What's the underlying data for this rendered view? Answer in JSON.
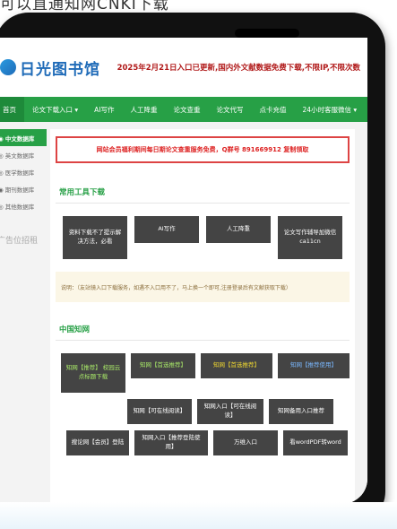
{
  "caption": "可以直通知网CNKI下载",
  "header": {
    "logo_text": "日光图书馆",
    "notice": "2025年2月21日入口已更新,国内外文献数据免费下载,不限IP,不限次数"
  },
  "nav": [
    {
      "label": "首页"
    },
    {
      "label": "论文下载入口 ▾"
    },
    {
      "label": "AI写作"
    },
    {
      "label": "人工降重"
    },
    {
      "label": "论文查重"
    },
    {
      "label": "论文代写"
    },
    {
      "label": "点卡充值"
    },
    {
      "label": "24小时客服微信 ▾"
    }
  ],
  "sidebar": {
    "items": [
      {
        "label": "◉ 中文数据库",
        "active": true
      },
      {
        "label": "◎ 英文数据库",
        "active": false
      },
      {
        "label": "◎ 医学数据库",
        "active": false
      },
      {
        "label": "◉ 期刊数据库",
        "active": false
      },
      {
        "label": "◎ 其他数据库",
        "active": false
      }
    ],
    "ad_label": "广告位招租"
  },
  "alert": "网站会员福利期间每日期论文查重服务免费，Q群号 891669912 复制领取",
  "tools": {
    "title": "常用工具下载",
    "buttons": [
      {
        "label": "资料下载不了提示解决方法，必看"
      },
      {
        "label": "AI写作"
      },
      {
        "label": "人工降重"
      },
      {
        "label": "论文写作辅导加微信 ca11cn"
      }
    ]
  },
  "tip": "说明：（友站镜入口下载服务，如遇不入口用不了，马上换一个即可,注册登录后有文献获取下载）",
  "cnki": {
    "title": "中国知网",
    "row1": [
      {
        "label": "知网【推荐】 校园云点标题下载",
        "color": "green"
      },
      {
        "label": "知网【首选推荐】",
        "color": "green"
      },
      {
        "label": "知网【首选推荐】",
        "color": "yellow"
      },
      {
        "label": "知网【推荐使用】",
        "color": "blue"
      }
    ],
    "row2": [
      {
        "label": "知网【可在线阅读】"
      },
      {
        "label": "知网入口【可在线阅读】"
      },
      {
        "label": "知网备用入口推荐"
      }
    ],
    "row3": [
      {
        "label": "搜论网【会员】登陆"
      },
      {
        "label": "知网入口【推荐登陆使用】"
      },
      {
        "label": "万维入口"
      },
      {
        "label": "看wordPDF转word"
      }
    ]
  },
  "colors": {
    "nav_green": "#27a046",
    "alert_red": "#dd4444",
    "button_dark": "#444444",
    "logo_blue": "#1f6bb8"
  }
}
